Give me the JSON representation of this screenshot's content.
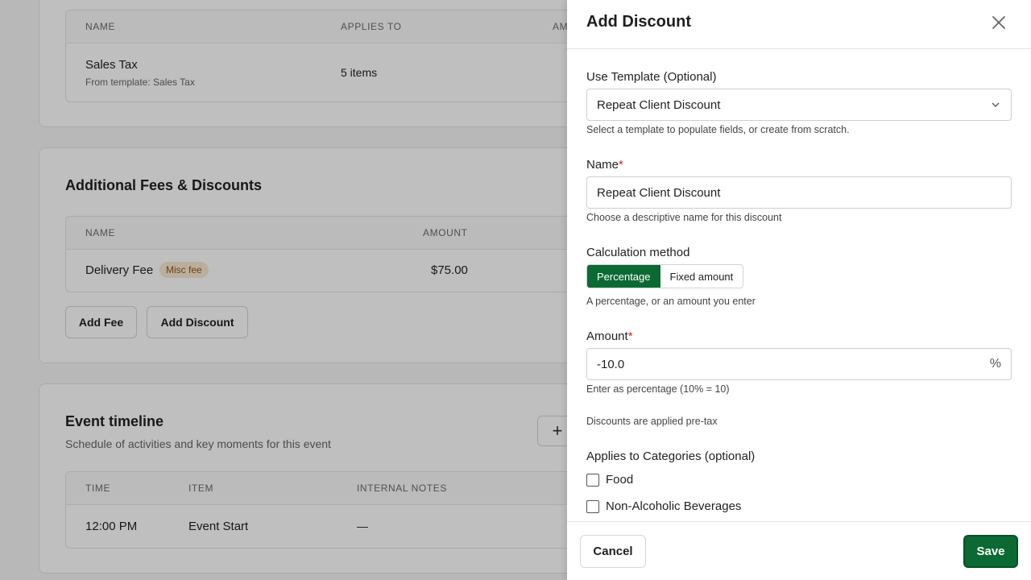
{
  "background": {
    "tax_table": {
      "headers": [
        "NAME",
        "APPLIES TO",
        "AM"
      ],
      "row": {
        "name": "Sales Tax",
        "sub": "From template: Sales Tax",
        "applies_to": "5 items"
      }
    },
    "fees": {
      "title": "Additional Fees & Discounts",
      "headers": [
        "NAME",
        "AMOUNT"
      ],
      "row": {
        "name": "Delivery Fee",
        "badge": "Misc fee",
        "amount": "$75.00"
      },
      "add_fee_label": "Add Fee",
      "add_discount_label": "Add Discount"
    },
    "timeline": {
      "title": "Event timeline",
      "subtitle": "Schedule of activities and key moments for this event",
      "plus_label": "+",
      "headers": [
        "TIME",
        "ITEM",
        "INTERNAL NOTES"
      ],
      "row": {
        "time": "12:00 PM",
        "item": "Event Start",
        "notes": "—"
      }
    }
  },
  "drawer": {
    "title": "Add Discount",
    "template": {
      "label": "Use Template (Optional)",
      "value": "Repeat Client Discount",
      "help": "Select a template to populate fields, or create from scratch."
    },
    "name": {
      "label": "Name",
      "required": "*",
      "value": "Repeat Client Discount",
      "help": "Choose a descriptive name for this discount"
    },
    "calculation": {
      "label": "Calculation method",
      "options": [
        "Percentage",
        "Fixed amount"
      ],
      "selected": "Percentage",
      "help": "A percentage, or an amount you enter"
    },
    "amount": {
      "label": "Amount",
      "required": "*",
      "value": "-10.0",
      "unit": "%",
      "help": "Enter as percentage (10% = 10)"
    },
    "pretax_note": "Discounts are applied pre-tax",
    "categories": {
      "label": "Applies to Categories (optional)",
      "items": [
        "Food",
        "Non-Alcoholic Beverages"
      ]
    },
    "footer": {
      "cancel_label": "Cancel",
      "save_label": "Save"
    }
  },
  "colors": {
    "primary": "#0b6a34",
    "required": "#c62828",
    "badge_bg": "#fbe9d2"
  }
}
